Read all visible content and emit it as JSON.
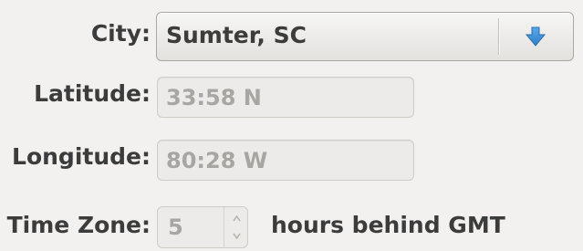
{
  "form": {
    "city": {
      "label": "City:",
      "value": "Sumter, SC",
      "arrow_icon": "arrow-down-icon",
      "arrow_color": "#3d8fd6"
    },
    "latitude": {
      "label": "Latitude:",
      "value": "33:58 N"
    },
    "longitude": {
      "label": "Longitude:",
      "value": "80:28 W"
    },
    "timezone": {
      "label": "Time Zone:",
      "value": "5",
      "suffix": "hours behind GMT"
    }
  }
}
